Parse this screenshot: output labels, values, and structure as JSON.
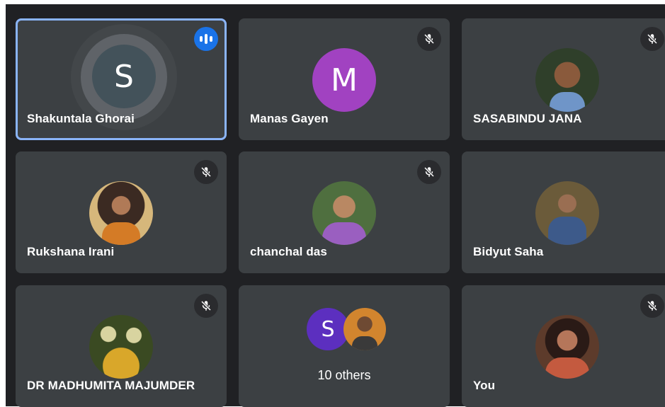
{
  "participants": [
    {
      "name": "Shakuntala Ghorai",
      "initial": "S",
      "speaking": true
    },
    {
      "name": "Manas Gayen",
      "initial": "M",
      "muted": true
    },
    {
      "name": "SASABINDU JANA",
      "muted": true
    },
    {
      "name": "Rukshana Irani",
      "muted": true
    },
    {
      "name": "chanchal das",
      "muted": true
    },
    {
      "name": "Bidyut Saha"
    },
    {
      "name": "DR MADHUMITA MAJUMDER",
      "muted": true
    },
    {
      "name": "You",
      "muted": true
    }
  ],
  "others": {
    "initial": "S",
    "label": "10 others"
  },
  "icons": {
    "mute": "mic-off-icon",
    "speaking": "audio-level-icon"
  },
  "colors": {
    "tile": "#3c4043",
    "background": "#202124",
    "active_border": "#8ab4f8",
    "speaking_badge": "#1a73e8",
    "avatar_m": "#a142c1",
    "avatar_s": "#5c2fbf"
  }
}
